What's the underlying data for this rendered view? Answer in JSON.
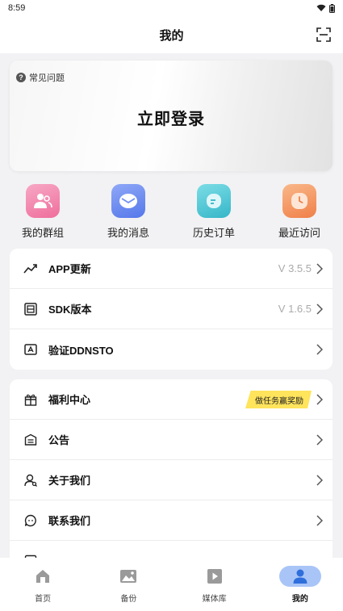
{
  "status_bar": {
    "time": "8:59"
  },
  "header": {
    "title": "我的"
  },
  "login_card": {
    "faq_label": "常见问题",
    "login_label": "立即登录"
  },
  "quick_actions": [
    {
      "label": "我的群组",
      "icon": "group-icon",
      "color": "#f38ab0"
    },
    {
      "label": "我的消息",
      "icon": "message-icon",
      "color": "#6f8ff2"
    },
    {
      "label": "历史订单",
      "icon": "order-icon",
      "color": "#4fc8d6"
    },
    {
      "label": "最近访问",
      "icon": "clock-icon",
      "color": "#f59a60"
    }
  ],
  "info_list": [
    {
      "label": "APP更新",
      "value": "V 3.5.5",
      "icon": "trend-icon"
    },
    {
      "label": "SDK版本",
      "value": "V 1.6.5",
      "icon": "sdk-icon"
    },
    {
      "label": "验证DDNSTO",
      "value": "",
      "icon": "verify-icon"
    }
  ],
  "menu_list": [
    {
      "label": "福利中心",
      "badge": "做任务赢奖励",
      "icon": "gift-icon"
    },
    {
      "label": "公告",
      "icon": "notice-icon"
    },
    {
      "label": "关于我们",
      "icon": "about-icon"
    },
    {
      "label": "联系我们",
      "icon": "contact-icon"
    }
  ],
  "tabbar": [
    {
      "label": "首页",
      "icon": "home-icon"
    },
    {
      "label": "备份",
      "icon": "backup-icon"
    },
    {
      "label": "媒体库",
      "icon": "media-icon"
    },
    {
      "label": "我的",
      "icon": "profile-icon",
      "active": true
    }
  ],
  "accent_color": "#2f6fdc"
}
